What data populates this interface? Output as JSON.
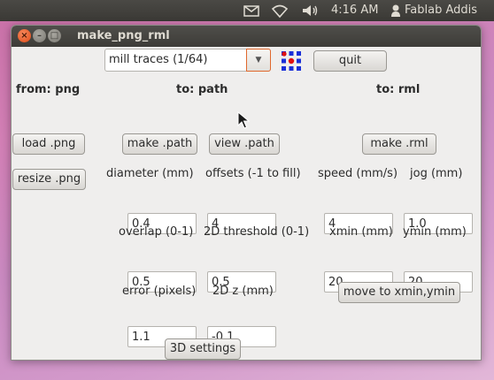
{
  "panel": {
    "clock": "4:16 AM",
    "user": "Fablab Addis",
    "icons": [
      "mail-icon",
      "wifi-icon",
      "volume-icon",
      "user-icon"
    ]
  },
  "window": {
    "title": "make_png_rml",
    "controls": [
      "close-icon",
      "minimize-icon",
      "maximize-icon"
    ]
  },
  "toolbar": {
    "mode_value": "mill traces (1/64)",
    "quit_label": "quit"
  },
  "columns": {
    "from": "from: png",
    "path": "to: path",
    "rml": "to: rml"
  },
  "buttons": {
    "load_png": "load .png",
    "resize_png": "resize .png",
    "make_path": "make .path",
    "view_path": "view .path",
    "make_rml": "make .rml",
    "move_to": "move to xmin,ymin",
    "settings_3d": "3D settings"
  },
  "path_fields": {
    "diameter": {
      "label": "diameter (mm)",
      "value": "0.4"
    },
    "offsets": {
      "label": "offsets (-1 to fill)",
      "value": "4"
    },
    "overlap": {
      "label": "overlap (0-1)",
      "value": "0.5"
    },
    "threshold_2d": {
      "label": "2D threshold (0-1)",
      "value": "0.5"
    },
    "error": {
      "label": "error (pixels)",
      "value": "1.1"
    },
    "z_2d": {
      "label": "2D z (mm)",
      "value": "-0.1"
    }
  },
  "rml_fields": {
    "speed": {
      "label": "speed (mm/s)",
      "value": "4"
    },
    "jog": {
      "label": "jog (mm)",
      "value": "1.0"
    },
    "xmin": {
      "label": "xmin (mm)",
      "value": "20"
    },
    "ymin": {
      "label": "ymin (mm)",
      "value": "20"
    }
  },
  "colors": {
    "panel": "#3c3b37",
    "window_bg": "#efeeed",
    "close_button": "#e5541a",
    "combo_focus": "#e0682d",
    "logo_blue": "#1a2fd8",
    "logo_red": "#e01010",
    "desktop": "#cf80b8"
  }
}
